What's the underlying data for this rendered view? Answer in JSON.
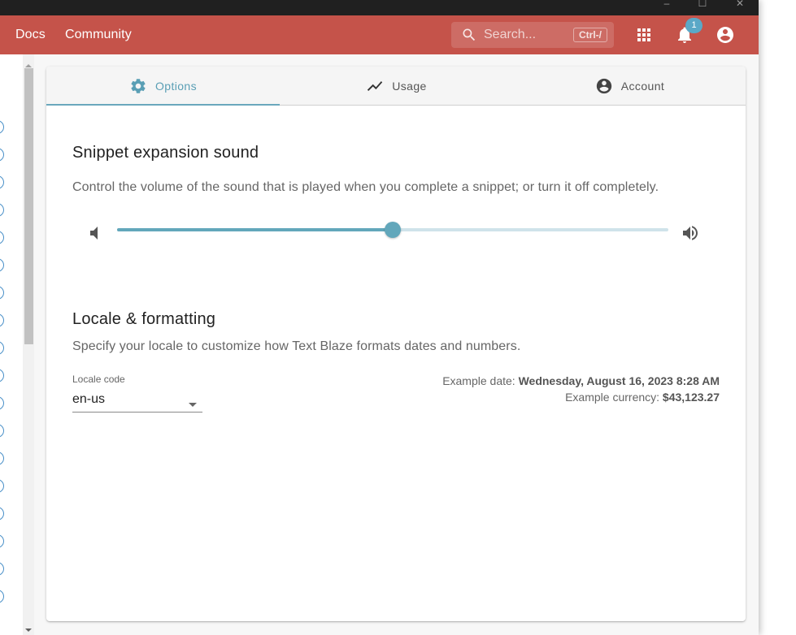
{
  "window": {
    "controls": {
      "minimize": "–",
      "maximize": "☐",
      "close": "✕"
    }
  },
  "appbar": {
    "nav": [
      {
        "label": "Docs"
      },
      {
        "label": "Community"
      }
    ],
    "search": {
      "placeholder": "Search...",
      "shortcut": "Ctrl-/"
    },
    "notifications": {
      "count": "1"
    },
    "icons": [
      "apps-grid-icon",
      "bell-icon",
      "account-circle-icon"
    ]
  },
  "tabs": [
    {
      "label": "Options",
      "icon": "gear-icon",
      "active": true
    },
    {
      "label": "Usage",
      "icon": "trending-line-icon",
      "active": false
    },
    {
      "label": "Account",
      "icon": "account-circle-icon",
      "active": false
    }
  ],
  "sound": {
    "title": "Snippet expansion sound",
    "description": "Control the volume of the sound that is played when you complete a snippet; or turn it off completely.",
    "volume_fraction": 0.5
  },
  "locale": {
    "title": "Locale & formatting",
    "description": "Specify your locale to customize how Text Blaze formats dates and numbers.",
    "field_label": "Locale code",
    "value": "en-us",
    "example_date_label": "Example date:",
    "example_date": "Wednesday, August 16, 2023 8:28 AM",
    "example_currency_label": "Example currency:",
    "example_currency": "$43,123.27"
  },
  "colors": {
    "appbar": "#c5534a",
    "accent": "#62a7bb",
    "badge": "#5aa8c7"
  }
}
